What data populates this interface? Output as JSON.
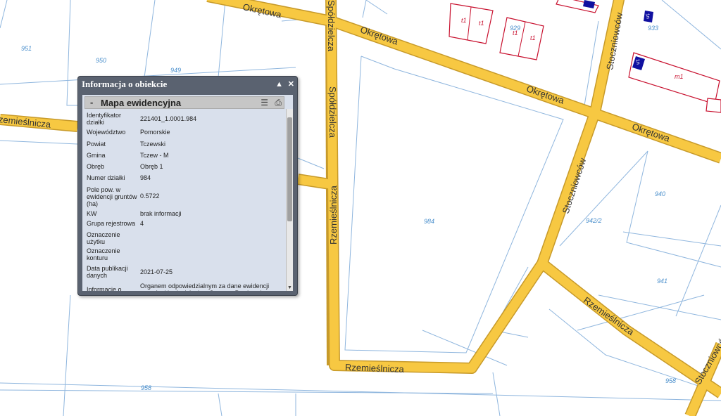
{
  "map": {
    "streets": {
      "okretowa": "Okrętowa",
      "spoldzielcza": "Spółdzielcza",
      "rzemieslnicza": "Rzemieślnicza",
      "stoczniowcow": "Stoczniowców",
      "zemieslnicza_cut": "zemieślnicza"
    },
    "parcels": [
      "951",
      "950",
      "949",
      "984",
      "940",
      "942/2",
      "941",
      "929",
      "933",
      "958",
      "958"
    ],
    "buildings": [
      "t1",
      "t1",
      "t1",
      "t1",
      "m1",
      "1n",
      "1n"
    ]
  },
  "panel": {
    "title": "Informacja o obiekcie",
    "minimize_glyph": "▲",
    "close_glyph": "✕",
    "section": {
      "toggle": "-",
      "title": "Mapa ewidencyjna",
      "list_icon": "☰",
      "print_icon": "⎙"
    },
    "rows": [
      {
        "label": "Identyfikator działki",
        "value": "221401_1.0001.984"
      },
      {
        "label": "Województwo",
        "value": "Pomorskie"
      },
      {
        "label": "Powiat",
        "value": "Tczewski"
      },
      {
        "label": "Gmina",
        "value": "Tczew - M"
      },
      {
        "label": "Obręb",
        "value": "Obręb 1"
      },
      {
        "label": "Numer działki",
        "value": "984"
      },
      {
        "label": "Pole pow. w ewidencji gruntów (ha)",
        "value": "0.5722"
      },
      {
        "label": "KW",
        "value": "brak informacji"
      },
      {
        "label": "Grupa rejestrowa",
        "value": "4"
      },
      {
        "label": "Oznaczenie użytku",
        "value": ""
      },
      {
        "label": "Oznaczenie konturu",
        "value": ""
      },
      {
        "label": "Data publikacji danych",
        "value": "2021-07-25"
      },
      {
        "label": "Informacje o pochodzeniu",
        "value": "Organem odpowiedzialnym za dane ewidencji gruntów i budynków jest Starosta Powiatu (ustawa"
      }
    ],
    "scroll_down_glyph": "▼"
  }
}
